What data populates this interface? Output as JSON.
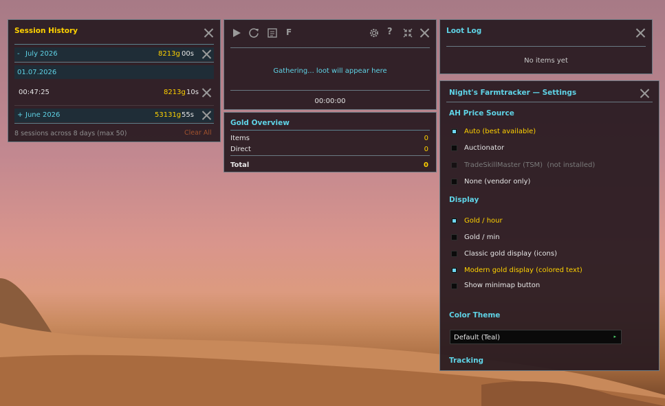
{
  "session_history": {
    "title": "Session History",
    "months": [
      {
        "toggle": "-",
        "label": "July 2026",
        "gold": "8213g",
        "time": "00s"
      },
      {
        "toggle": "+",
        "label": "June 2026",
        "gold": "53131g",
        "time": "55s"
      }
    ],
    "day_label": "01.07.2026",
    "session": {
      "time": "00:47:25",
      "gold": "8213g",
      "secs": "10s"
    },
    "footer": "8 sessions across 8 days (max 50)",
    "clear_all": "Clear All"
  },
  "tracker": {
    "toolbar_f": "F",
    "message": "Gathering... loot will appear here",
    "timer": "00:00:00"
  },
  "gold_overview": {
    "title": "Gold Overview",
    "rows": [
      {
        "label": "Items",
        "value": "0"
      },
      {
        "label": "Direct",
        "value": "0"
      }
    ],
    "total_label": "Total",
    "total_value": "0"
  },
  "loot_log": {
    "title": "Loot Log",
    "empty": "No items yet"
  },
  "settings": {
    "title": "Night's Farmtracker — Settings",
    "price_section": "AH Price Source",
    "price_options": [
      {
        "label": "Auto (best available)",
        "checked": true
      },
      {
        "label": "Auctionator",
        "checked": false
      },
      {
        "label": "TradeSkillMaster (TSM)  (not installed)",
        "checked": false,
        "disabled": true
      },
      {
        "label": "None (vendor only)",
        "checked": false
      }
    ],
    "display_section": "Display",
    "display_options": [
      {
        "label": "Gold / hour",
        "checked": true
      },
      {
        "label": "Gold / min",
        "checked": false
      },
      {
        "label": "Classic gold display (icons)",
        "checked": false
      },
      {
        "label": "Modern gold display (colored text)",
        "checked": true
      },
      {
        "label": "Show minimap button",
        "checked": false
      }
    ],
    "theme_section": "Color Theme",
    "theme_value": "Default (Teal)",
    "tracking_section": "Tracking"
  },
  "colors": {
    "accent": "#5fd3e6",
    "gold": "#ffd200",
    "clear_all": "#a0522d",
    "panel_bg": "#281a20"
  },
  "icons": [
    "play-icon",
    "reset-icon",
    "minimap-icon",
    "gear-icon",
    "help-icon",
    "collapse-icon",
    "close-icon"
  ]
}
